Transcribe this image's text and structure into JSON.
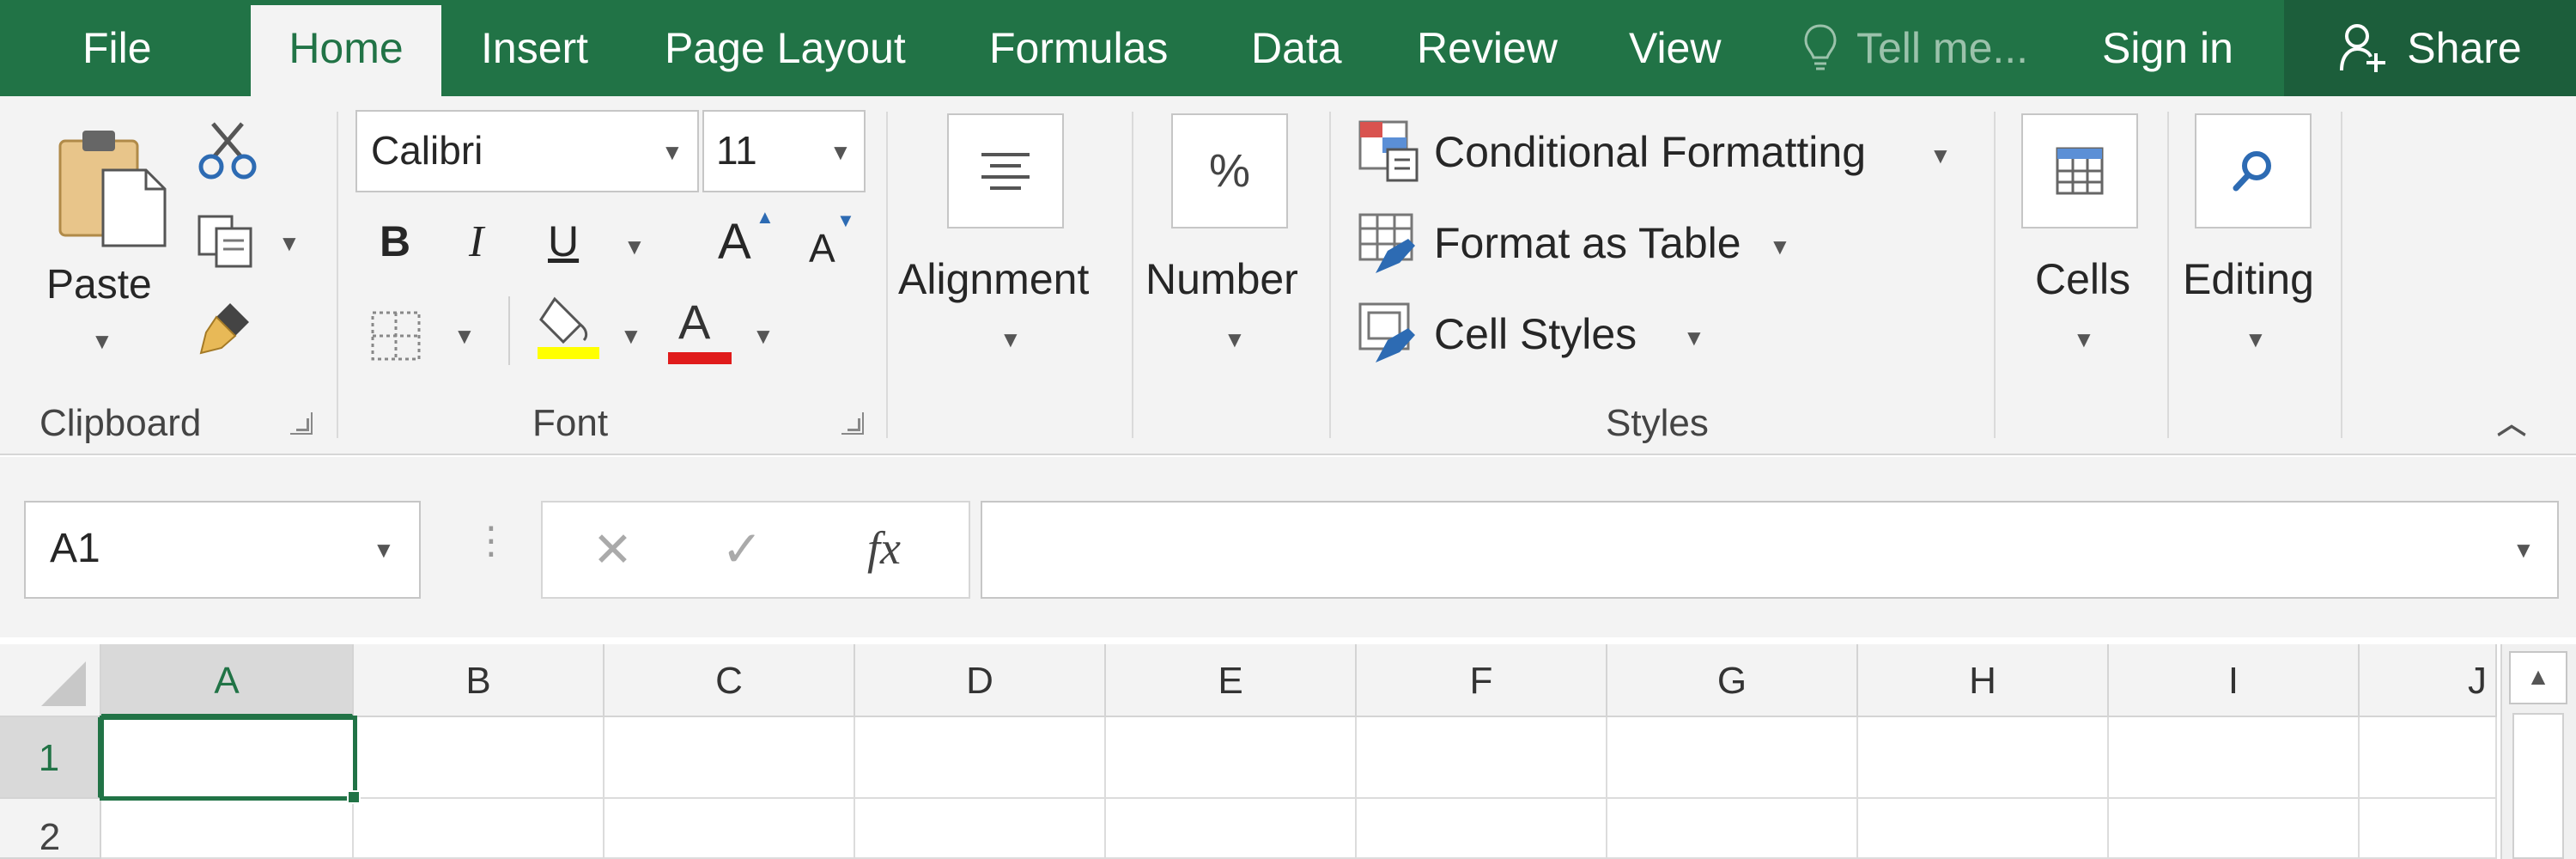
{
  "colors": {
    "brand": "#217346",
    "share_bg": "#1c5e3b",
    "ribbon_bg": "#f3f3f3",
    "selection": "#217346"
  },
  "tabs": [
    "File",
    "Home",
    "Insert",
    "Page Layout",
    "Formulas",
    "Data",
    "Review",
    "View"
  ],
  "tell_me": {
    "icon": "lightbulb-icon",
    "text": "Tell me..."
  },
  "sign_in": "Sign in",
  "share": {
    "icon": "person-add-icon",
    "label": "Share"
  },
  "ribbon": {
    "clipboard": {
      "paste": "Paste",
      "group": "Clipboard",
      "icons": [
        "paste-icon",
        "cut-icon",
        "copy-icon",
        "format-painter-icon"
      ]
    },
    "font": {
      "family": "Calibri",
      "size": "11",
      "bold": "B",
      "italic": "I",
      "underline": "U",
      "grow": "A",
      "shrink": "A",
      "font_color": "A",
      "group": "Font"
    },
    "alignment": "Alignment",
    "number": {
      "symbol": "%",
      "label": "Number"
    },
    "styles": {
      "conditional": "Conditional Formatting",
      "table": "Format as Table",
      "cell_styles": "Cell Styles",
      "group": "Styles"
    },
    "cells": "Cells",
    "editing": "Editing"
  },
  "formula_bar": {
    "name_box": "A1",
    "cancel": "✕",
    "enter": "✓",
    "fx": "fx",
    "value": ""
  },
  "sheet": {
    "columns": [
      "A",
      "B",
      "C",
      "D",
      "E",
      "F",
      "G",
      "H",
      "I",
      "J"
    ],
    "rows": [
      "1",
      "2"
    ],
    "active_cell": "A1"
  }
}
